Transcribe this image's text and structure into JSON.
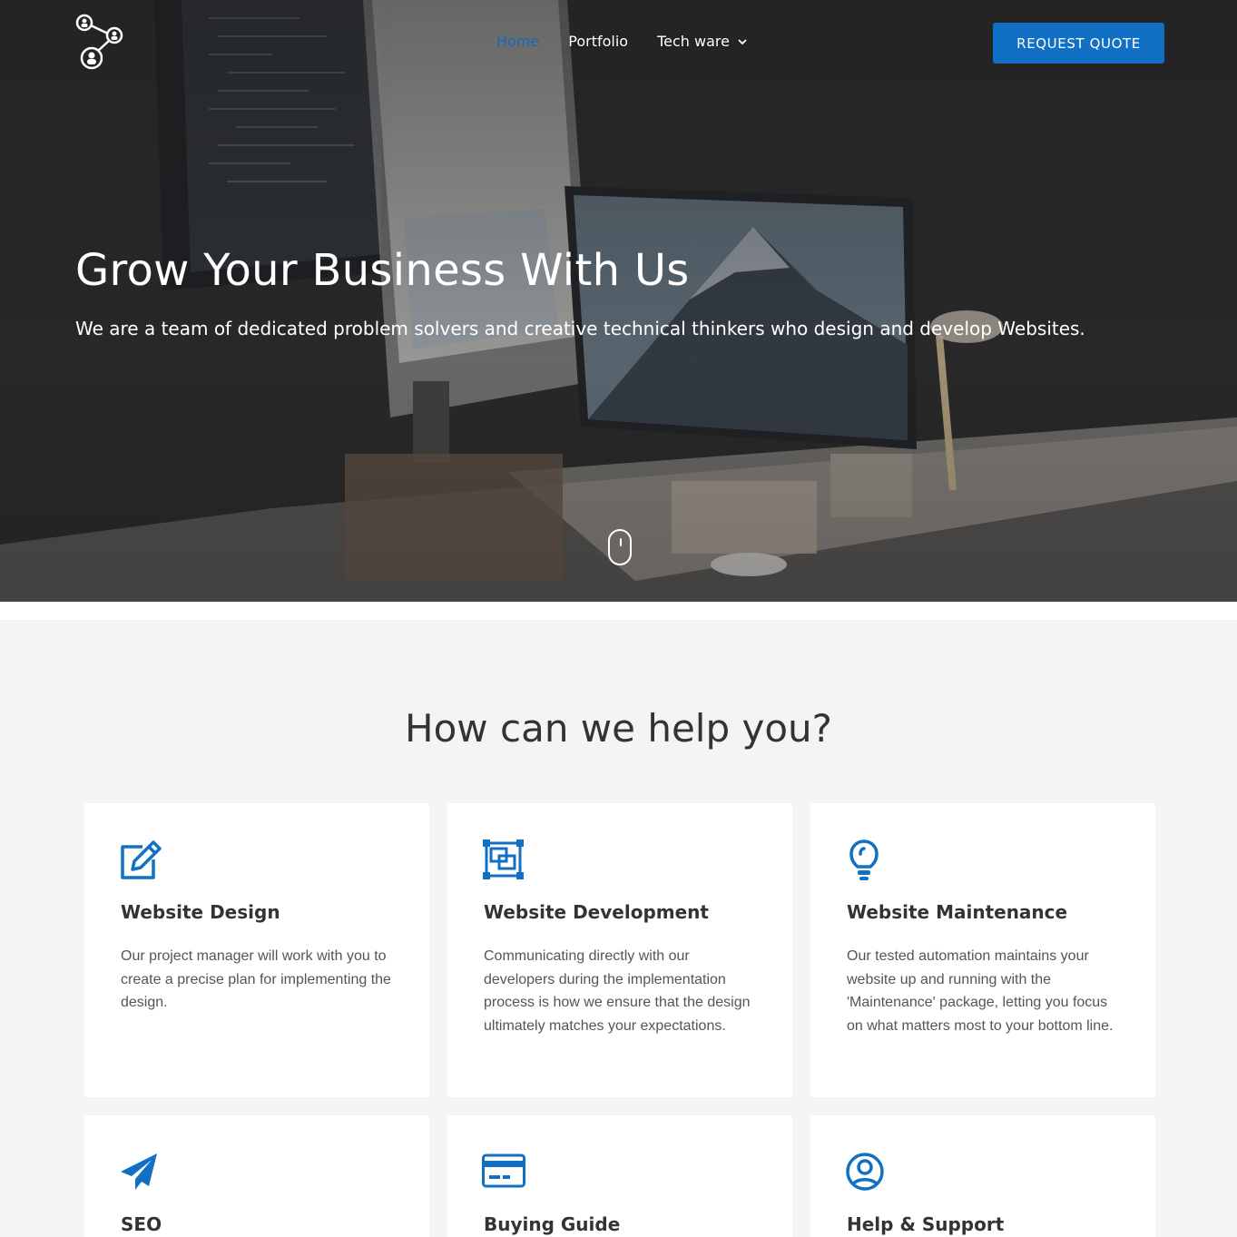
{
  "header": {
    "logo_icon": "network-people-icon",
    "nav": [
      {
        "label": "Home",
        "active": true
      },
      {
        "label": "Portfolio",
        "active": false
      },
      {
        "label": "Tech ware",
        "active": false,
        "dropdown": true
      }
    ],
    "cta_label": "REQUEST QUOTE"
  },
  "hero": {
    "title": "Grow Your Business With Us",
    "subtitle": "We are a team of dedicated problem solvers and creative technical thinkers who design and develop Websites.",
    "scroll_icon": "mouse-scroll-icon"
  },
  "services": {
    "title": "How can we help you?",
    "items": [
      {
        "icon": "edit-icon",
        "title": "Website Design",
        "text": "Our project manager will work with you to create a precise plan for implementing the design."
      },
      {
        "icon": "layers-icon",
        "title": "Website Development",
        "text": "Communicating directly with our developers during the implementation process is how we ensure that the design ultimately matches your expectations."
      },
      {
        "icon": "lightbulb-icon",
        "title": "Website Maintenance",
        "text": "Our tested automation maintains your website up and running with the 'Maintenance' package, letting you focus on what matters most to your bottom line."
      },
      {
        "icon": "paper-plane-icon",
        "title": "SEO",
        "text": ""
      },
      {
        "icon": "credit-card-icon",
        "title": "Buying Guide",
        "text": ""
      },
      {
        "icon": "user-circle-icon",
        "title": "Help & Support",
        "text": ""
      }
    ]
  },
  "colors": {
    "accent": "#1170c3",
    "nav_active": "#1769bd",
    "hero_bg": "#2a2a2b",
    "section_bg": "#f4f4f4",
    "card_bg": "#ffffff",
    "heading": "#333333"
  }
}
